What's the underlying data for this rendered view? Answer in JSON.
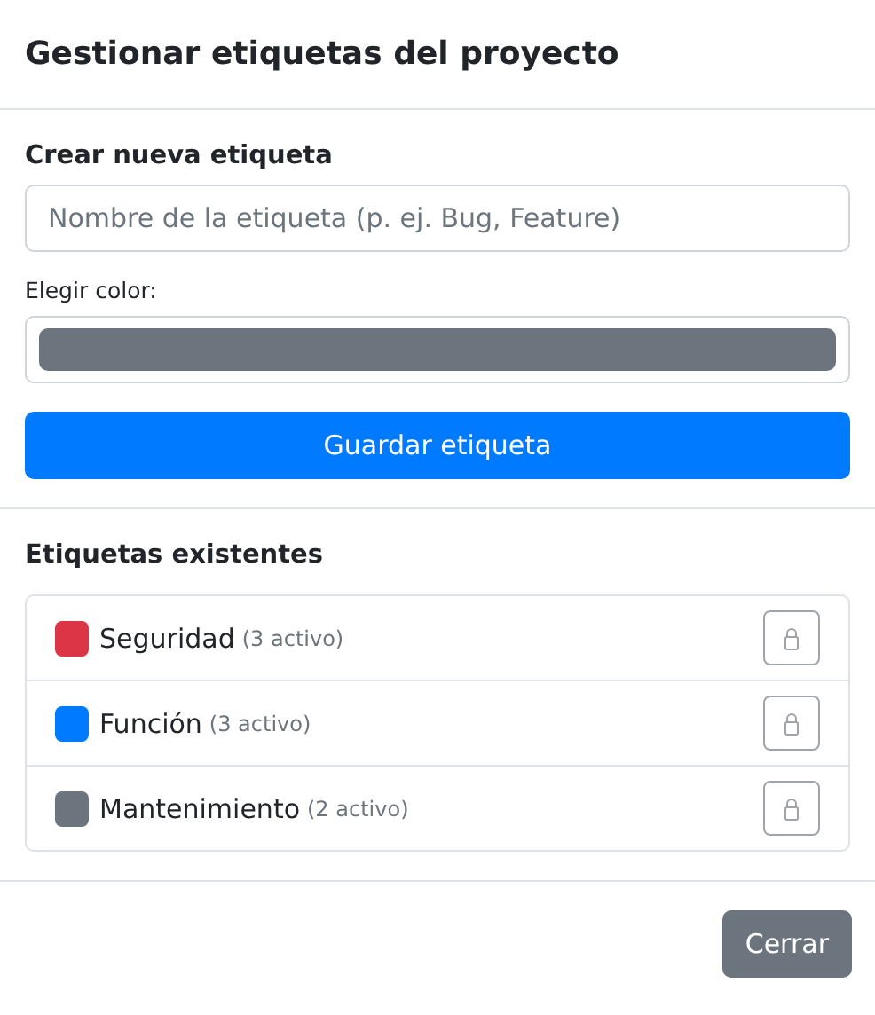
{
  "modal": {
    "title": "Gestionar etiquetas del proyecto"
  },
  "create": {
    "heading": "Crear nueva etiqueta",
    "name_field": {
      "placeholder": "Nombre de la etiqueta (p. ej. Bug, Feature)"
    },
    "color_label": "Elegir color:",
    "color_field": {
      "color": "#6c757d"
    },
    "save_button": "Guardar etiqueta"
  },
  "existing": {
    "heading": "Etiquetas existentes",
    "tags": [
      {
        "name": "Seguridad",
        "count": "(3 activo)",
        "color": "#dc3545",
        "disabled": true
      },
      {
        "name": "Función",
        "count": "(3 activo)",
        "color": "#007bff",
        "disabled": true
      },
      {
        "name": "Mantenimiento",
        "count": "(2 activo)",
        "color": "#6c757d",
        "disabled": true
      }
    ]
  },
  "footer": {
    "close_button": "Cerrar"
  }
}
